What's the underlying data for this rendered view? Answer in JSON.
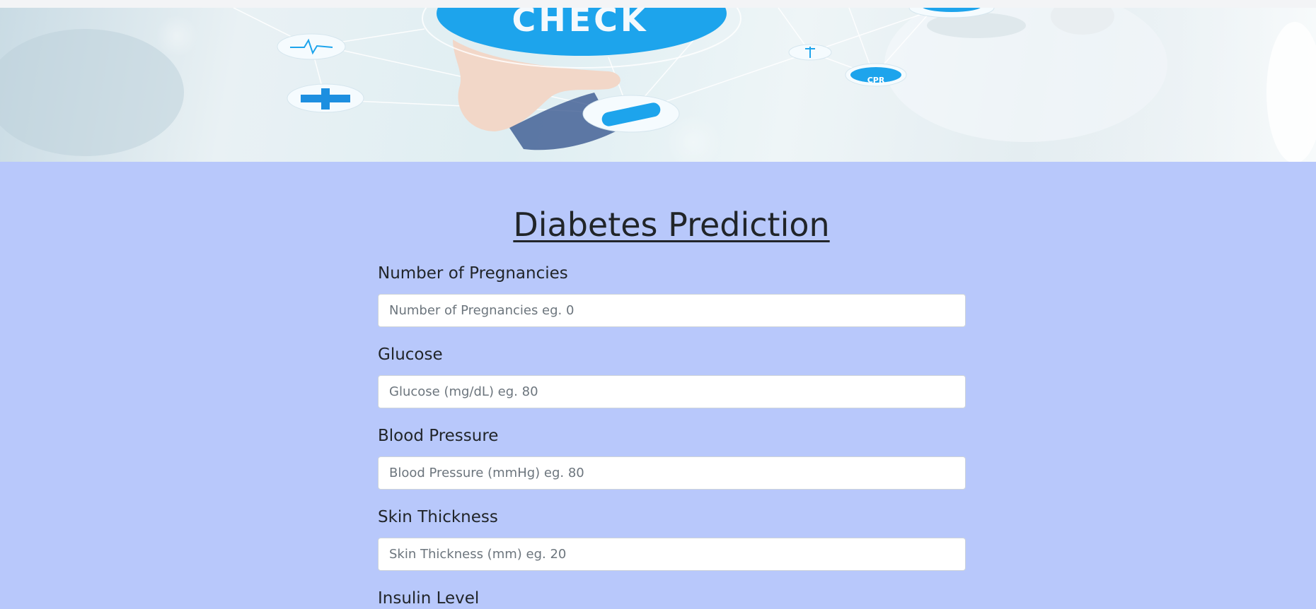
{
  "hero": {
    "badge_text": "CHECK",
    "cpr_text": "CPR"
  },
  "form": {
    "title": "Diabetes Prediction",
    "fields": [
      {
        "label": "Number of Pregnancies",
        "placeholder": "Number of Pregnancies eg. 0",
        "value": ""
      },
      {
        "label": "Glucose",
        "placeholder": "Glucose (mg/dL) eg. 80",
        "value": ""
      },
      {
        "label": "Blood Pressure",
        "placeholder": "Blood Pressure (mmHg) eg. 80",
        "value": ""
      },
      {
        "label": "Skin Thickness",
        "placeholder": "Skin Thickness (mm) eg. 20",
        "value": ""
      },
      {
        "label": "Insulin Level",
        "placeholder": "",
        "value": ""
      }
    ]
  },
  "colors": {
    "page_background": "#b8c8fb",
    "hero_accent": "#1da4ec"
  }
}
